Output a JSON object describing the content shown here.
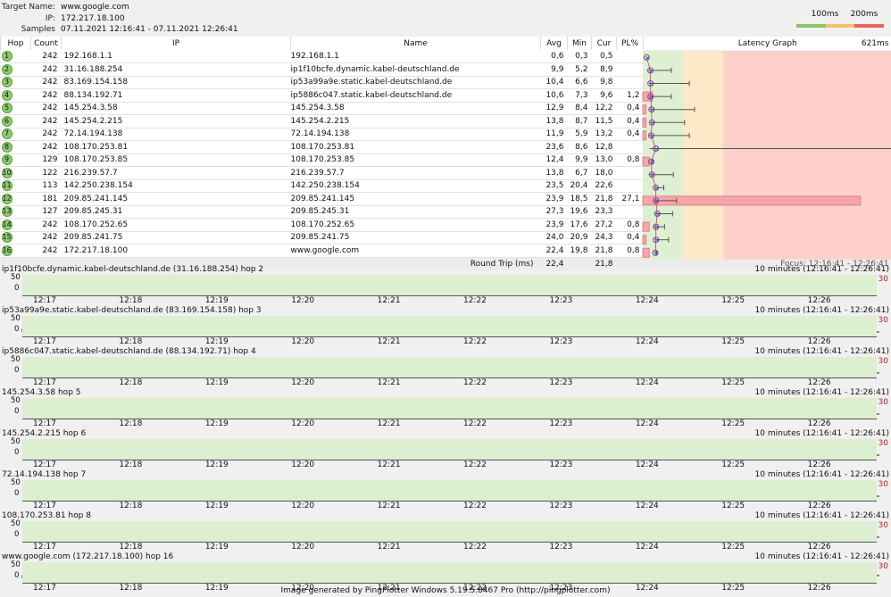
{
  "header": {
    "target_label": "Target Name:",
    "target": "www.google.com",
    "ip_label": "IP:",
    "ip": "172.217.18.100",
    "samples_label": "Samples Timed:",
    "samples": "07.11.2021 12:16:41 - 07.11.2021 12:26:41"
  },
  "legend": {
    "l100": "100ms",
    "l200": "200ms",
    "colors": [
      "#8cc46a",
      "#f3c46a",
      "#e8665a"
    ]
  },
  "columns": {
    "hop": "Hop",
    "count": "Count",
    "ip": "IP",
    "name": "Name",
    "avg": "Avg",
    "min": "Min",
    "cur": "Cur",
    "pl": "PL%",
    "graph": "Latency Graph",
    "graph_max": "621ms"
  },
  "hops": [
    {
      "hop": "1",
      "count": "242",
      "ip": "192.168.1.1",
      "name": "192.168.1.1",
      "avg": "0,6",
      "min": "0,3",
      "cur": "0,5",
      "pl": "",
      "jitter_max_ms": 0
    },
    {
      "hop": "2",
      "count": "242",
      "ip": "31.16.188.254",
      "name": "ip1f10bcfe.dynamic.kabel-deutschland.de",
      "avg": "9,9",
      "min": "5,2",
      "cur": "8,9",
      "pl": "",
      "jitter_max_ms": 67
    },
    {
      "hop": "3",
      "count": "242",
      "ip": "83.169.154.158",
      "name": "ip53a99a9e.static.kabel-deutschland.de",
      "avg": "10,4",
      "min": "6,6",
      "cur": "9,8",
      "pl": "",
      "jitter_max_ms": 112
    },
    {
      "hop": "4",
      "count": "242",
      "ip": "88.134.192.71",
      "name": "ip5886c047.static.kabel-deutschland.de",
      "avg": "10,6",
      "min": "7,3",
      "cur": "9,6",
      "pl": "1,2",
      "jitter_max_ms": 67
    },
    {
      "hop": "5",
      "count": "242",
      "ip": "145.254.3.58",
      "name": "145.254.3.58",
      "avg": "12,9",
      "min": "8,4",
      "cur": "12,2",
      "pl": "0,4",
      "jitter_max_ms": 125
    },
    {
      "hop": "6",
      "count": "242",
      "ip": "145.254.2.215",
      "name": "145.254.2.215",
      "avg": "13,8",
      "min": "8,7",
      "cur": "11,5",
      "pl": "0,4",
      "jitter_max_ms": 100
    },
    {
      "hop": "7",
      "count": "242",
      "ip": "72.14.194.138",
      "name": "72.14.194.138",
      "avg": "11,9",
      "min": "5,9",
      "cur": "13,2",
      "pl": "0,4",
      "jitter_max_ms": 112
    },
    {
      "hop": "8",
      "count": "242",
      "ip": "108.170.253.81",
      "name": "108.170.253.81",
      "avg": "23,6",
      "min": "8,6",
      "cur": "12,8",
      "pl": "",
      "jitter_max_ms": 621
    },
    {
      "hop": "9",
      "count": "129",
      "ip": "108.170.253.85",
      "name": "108.170.253.85",
      "avg": "12,4",
      "min": "9,9",
      "cur": "13,0",
      "pl": "0,8",
      "jitter_max_ms": 20
    },
    {
      "hop": "10",
      "count": "122",
      "ip": "216.239.57.7",
      "name": "216.239.57.7",
      "avg": "13,8",
      "min": "6,7",
      "cur": "18,0",
      "pl": "",
      "jitter_max_ms": 72
    },
    {
      "hop": "11",
      "count": "113",
      "ip": "142.250.238.154",
      "name": "142.250.238.154",
      "avg": "23,5",
      "min": "20,4",
      "cur": "22,6",
      "pl": "",
      "jitter_max_ms": 48
    },
    {
      "hop": "12",
      "count": "181",
      "ip": "209.85.241.145",
      "name": "209.85.241.145",
      "avg": "23,9",
      "min": "18,5",
      "cur": "21,8",
      "pl": "27,1",
      "jitter_max_ms": 80
    },
    {
      "hop": "13",
      "count": "127",
      "ip": "209.85.245.31",
      "name": "209.85.245.31",
      "avg": "27,3",
      "min": "19,6",
      "cur": "23,3",
      "pl": "",
      "jitter_max_ms": 70
    },
    {
      "hop": "14",
      "count": "242",
      "ip": "108.170.252.65",
      "name": "108.170.252.65",
      "avg": "23,9",
      "min": "17,6",
      "cur": "27,2",
      "pl": "0,8",
      "jitter_max_ms": 50
    },
    {
      "hop": "15",
      "count": "242",
      "ip": "209.85.241.75",
      "name": "209.85.241.75",
      "avg": "24,0",
      "min": "20,9",
      "cur": "24,3",
      "pl": "0,4",
      "jitter_max_ms": 60
    },
    {
      "hop": "16",
      "count": "242",
      "ip": "172.217.18.100",
      "name": "www.google.com",
      "avg": "22,4",
      "min": "19,8",
      "cur": "21,8",
      "pl": "0,8",
      "jitter_max_ms": 30
    }
  ],
  "round_trip": {
    "label": "Round Trip (ms)",
    "avg": "22,4",
    "cur": "21,8",
    "focus": "Focus: 12:16:41 - 12:26:41"
  },
  "panels_common": {
    "range": "10 minutes (12:16:41 - 12:26:41)",
    "scale_max": "30",
    "y50": "50",
    "y0": "0",
    "ticks": [
      "12:17",
      "12:18",
      "12:19",
      "12:20",
      "12:21",
      "12:22",
      "12:23",
      "12:24",
      "12:25",
      "12:26"
    ]
  },
  "panels": [
    {
      "title": "ip1f10bcfe.dynamic.kabel-deutschland.de (31.16.188.254) hop 2",
      "flat": true,
      "loss_minutes": []
    },
    {
      "title": "ip53a99a9e.static.kabel-deutschland.de (83.169.154.158) hop 3",
      "flat": false,
      "loss_minutes": []
    },
    {
      "title": "ip5886c047.static.kabel-deutschland.de (88.134.192.71) hop 4",
      "flat": false,
      "loss_minutes": [
        1.31,
        1.61,
        2.06
      ]
    },
    {
      "title": "145.254.3.58 hop 5",
      "flat": false,
      "loss_minutes": [
        1.57
      ]
    },
    {
      "title": "145.254.2.215 hop 6",
      "flat": false,
      "loss_minutes": [
        8.26
      ]
    },
    {
      "title": "72.14.194.138 hop 7",
      "flat": false,
      "loss_minutes": [
        2.06
      ]
    },
    {
      "title": "108.170.253.81 hop 8",
      "flat": false,
      "loss_minutes": []
    },
    {
      "title": "www.google.com (172.217.18.100) hop 16",
      "flat": false,
      "loss_minutes": [
        1.32,
        8.32
      ]
    }
  ],
  "footer": "Image generated by PingPlotter Windows 5.19.5.8467 Pro (http://pingplotter.com)"
}
